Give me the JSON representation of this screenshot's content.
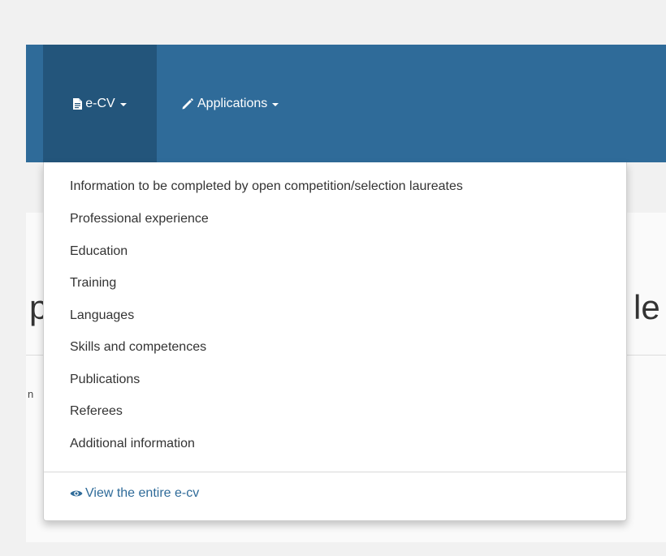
{
  "navbar": {
    "menus": [
      {
        "label": "e-CV",
        "icon": "document-icon"
      },
      {
        "label": "Applications",
        "icon": "pencil-icon"
      }
    ]
  },
  "dropdown": {
    "items": [
      "Information to be completed by open competition/selection laureates",
      "Professional experience",
      "Education",
      "Training",
      "Languages",
      "Skills and competences",
      "Publications",
      "Referees",
      "Additional information"
    ],
    "view_all": {
      "label": "View the entire e-cv",
      "icon": "eye-icon"
    }
  },
  "background": {
    "heading_left_fragment": "p",
    "heading_right_fragment": "le",
    "small_fragment": "n"
  },
  "colors": {
    "navbar": "#2f6b99",
    "navbar_active": "#23557b",
    "link": "#2f6b99"
  }
}
